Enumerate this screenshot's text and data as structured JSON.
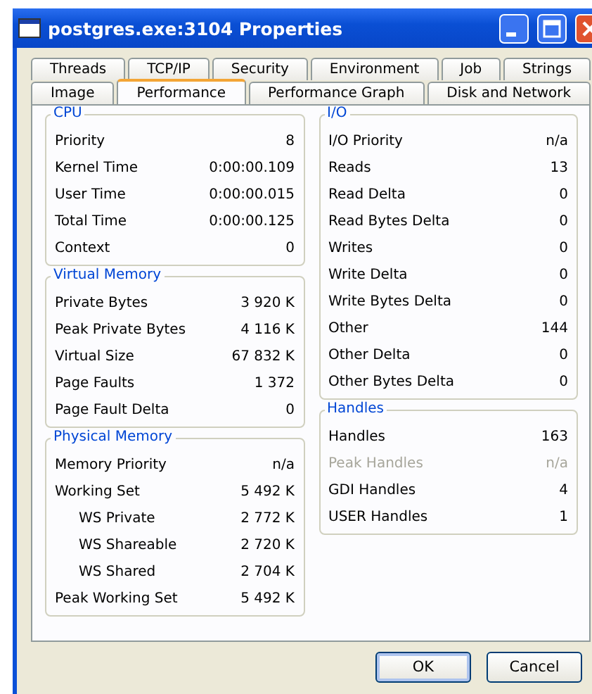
{
  "window": {
    "title": "postgres.exe:3104 Properties"
  },
  "tab_rows": [
    [
      {
        "label": "Threads",
        "selected": false
      },
      {
        "label": "TCP/IP",
        "selected": false
      },
      {
        "label": "Security",
        "selected": false
      },
      {
        "label": "Environment",
        "selected": false
      },
      {
        "label": "Job",
        "selected": false
      },
      {
        "label": "Strings",
        "selected": false
      }
    ],
    [
      {
        "label": "Image",
        "selected": false
      },
      {
        "label": "Performance",
        "selected": true
      },
      {
        "label": "Performance Graph",
        "selected": false
      },
      {
        "label": "Disk and Network",
        "selected": false
      }
    ]
  ],
  "columns": [
    [
      {
        "title": "CPU",
        "rows": [
          {
            "label": "Priority",
            "value": "8",
            "disabled": false
          },
          {
            "label": "Kernel Time",
            "value": "0:00:00.109",
            "disabled": false
          },
          {
            "label": "User Time",
            "value": "0:00:00.015",
            "disabled": false
          },
          {
            "label": "Total Time",
            "value": "0:00:00.125",
            "disabled": false
          },
          {
            "label": "Context",
            "value": "0",
            "disabled": false
          }
        ]
      },
      {
        "title": "Virtual Memory",
        "rows": [
          {
            "label": "Private Bytes",
            "value": "3 920 K",
            "disabled": false
          },
          {
            "label": "Peak Private Bytes",
            "value": "4 116 K",
            "disabled": false
          },
          {
            "label": "Virtual Size",
            "value": "67 832 K",
            "disabled": false
          },
          {
            "label": "Page Faults",
            "value": "1 372",
            "disabled": false
          },
          {
            "label": "Page Fault Delta",
            "value": "0",
            "disabled": false
          }
        ]
      },
      {
        "title": "Physical Memory",
        "rows": [
          {
            "label": "Memory Priority",
            "value": "n/a",
            "disabled": false
          },
          {
            "label": "Working Set",
            "value": "5 492 K",
            "disabled": false,
            "children": [
              {
                "label": "WS Private",
                "value": "2 772 K",
                "disabled": false
              },
              {
                "label": "WS Shareable",
                "value": "2 720 K",
                "disabled": false
              },
              {
                "label": "WS Shared",
                "value": "2 704 K",
                "disabled": false
              }
            ]
          },
          {
            "label": "Peak Working Set",
            "value": "5 492 K",
            "disabled": false
          }
        ]
      }
    ],
    [
      {
        "title": "I/O",
        "rows": [
          {
            "label": "I/O Priority",
            "value": "n/a",
            "disabled": false
          },
          {
            "label": "Reads",
            "value": "13",
            "disabled": false
          },
          {
            "label": "Read Delta",
            "value": "0",
            "disabled": false
          },
          {
            "label": "Read Bytes Delta",
            "value": "0",
            "disabled": false
          },
          {
            "label": "Writes",
            "value": "0",
            "disabled": false
          },
          {
            "label": "Write Delta",
            "value": "0",
            "disabled": false
          },
          {
            "label": "Write Bytes Delta",
            "value": "0",
            "disabled": false
          },
          {
            "label": "Other",
            "value": "144",
            "disabled": false
          },
          {
            "label": "Other Delta",
            "value": "0",
            "disabled": false
          },
          {
            "label": "Other Bytes Delta",
            "value": "0",
            "disabled": false
          }
        ]
      },
      {
        "title": "Handles",
        "rows": [
          {
            "label": "Handles",
            "value": "163",
            "disabled": false
          },
          {
            "label": "Peak Handles",
            "value": "n/a",
            "disabled": true
          },
          {
            "label": "GDI Handles",
            "value": "4",
            "disabled": false
          },
          {
            "label": "USER Handles",
            "value": "1",
            "disabled": false
          }
        ]
      }
    ]
  ],
  "buttons": [
    "OK",
    "Cancel"
  ]
}
